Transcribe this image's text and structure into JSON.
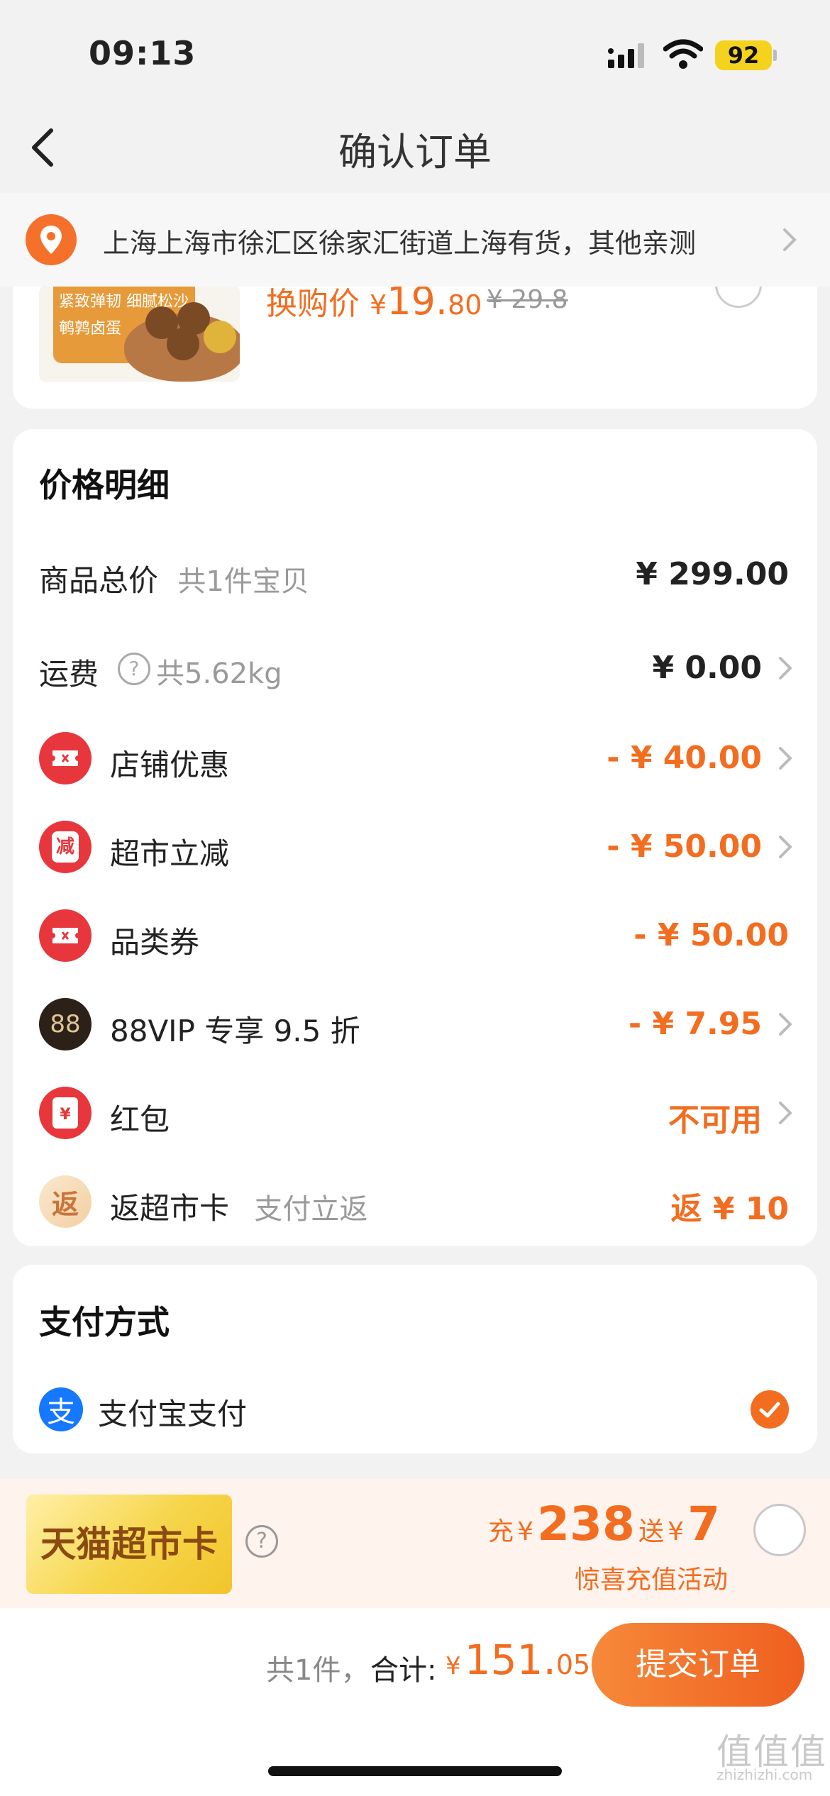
{
  "status_bar": {
    "time": "09:13",
    "battery": "92"
  },
  "nav": {
    "title": "确认订单"
  },
  "address": {
    "text": "上海上海市徐汇区徐家汇街道上海有货，其他亲测"
  },
  "product": {
    "image_lines": [
      "紧致弹韧 细腻松沙",
      "鹌鹑卤蛋"
    ],
    "promo_label": "换购价",
    "currency": "¥",
    "price_int": "19.",
    "price_dec": "80",
    "old_price": "¥ 29.8"
  },
  "price_detail": {
    "title": "价格明细",
    "rows": [
      {
        "label": "商品总价",
        "sub": "共1件宝贝",
        "amount": "¥ 299.00"
      },
      {
        "label": "运费",
        "sub": "共5.62kg",
        "amount": "¥ 0.00"
      },
      {
        "label": "店铺优惠",
        "amount": "- ¥ 40.00"
      },
      {
        "label": "超市立减",
        "icon_text": "减",
        "amount": "- ¥ 50.00"
      },
      {
        "label": "品类券",
        "amount": "- ¥ 50.00"
      },
      {
        "label": "88VIP 专享 9.5 折",
        "icon_text": "88",
        "amount": "- ¥ 7.95"
      },
      {
        "label": "红包",
        "icon_text": "¥",
        "amount": "不可用"
      },
      {
        "label": "返超市卡",
        "sub": "支付立返",
        "icon_text": "返",
        "amount": "返 ¥ 10"
      }
    ],
    "help_icon": "question-circle-icon"
  },
  "payment": {
    "title": "支付方式",
    "method_label": "支付宝支付",
    "method_icon_text": "支",
    "selected": true
  },
  "tmall_card": {
    "name": "天猫超市卡",
    "help": "?",
    "charge_label": "充",
    "charge_currency": "¥",
    "charge_amount": "238",
    "gift_label": "送",
    "gift_currency": "¥",
    "gift_amount": "7",
    "activity": "惊喜充值活动"
  },
  "footer": {
    "count_text": "共1件，",
    "total_label": "合计:",
    "currency": "¥",
    "total_int": "151.",
    "total_dec": "05",
    "submit_label": "提交订单"
  },
  "watermark": {
    "text": "值值值",
    "sub": "zhizhizhi.com"
  },
  "colors": {
    "accent": "#f36d20",
    "red_icon": "#e8373c",
    "alipay": "#1677ff"
  }
}
